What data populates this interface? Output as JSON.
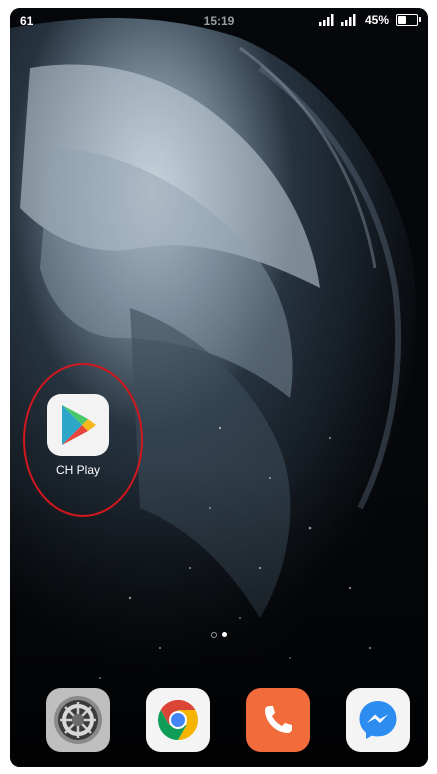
{
  "status_bar": {
    "left_text": "61",
    "time": "15:19",
    "battery_percent": "45%",
    "battery_level": 0.45,
    "signal_icons": [
      "signal-icon",
      "signal-icon"
    ]
  },
  "home": {
    "apps": [
      {
        "label": "CH Play",
        "icon": "google-play-icon"
      }
    ],
    "page_indicator": {
      "count": 2,
      "active_index": 1
    }
  },
  "dock": {
    "apps": [
      {
        "icon": "settings-gear-icon"
      },
      {
        "icon": "chrome-icon"
      },
      {
        "icon": "phone-icon"
      },
      {
        "icon": "messenger-icon"
      }
    ]
  },
  "colors": {
    "highlight": "#d2171e",
    "phone_orange": "#f26b3a",
    "messenger_blue": "#2d8cf0"
  }
}
